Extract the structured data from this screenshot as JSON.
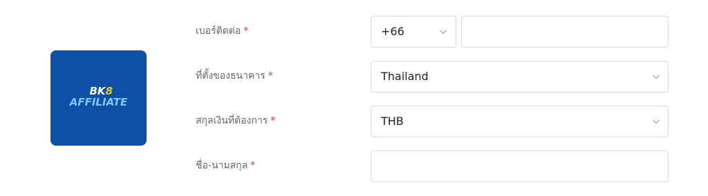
{
  "logo": {
    "brand_prefix": "BK",
    "brand_number": "8",
    "brand_sub": "AFFILIATE"
  },
  "form": {
    "required_mark": "*",
    "phone": {
      "label": "เบอร์ติดต่อ",
      "code": "+66",
      "value": ""
    },
    "bank_location": {
      "label": "ที่ตั้งของธนาคาร",
      "value": "Thailand"
    },
    "currency": {
      "label": "สกุลเงินที่ต้องการ",
      "value": "THB"
    },
    "full_name": {
      "label": "ชื่อ-นามสกุล",
      "value": ""
    }
  },
  "colors": {
    "logo_bg": "#0e4fa8",
    "required": "#d9343a",
    "border": "#d9d9d9"
  },
  "icons": [
    "chevron-down-icon"
  ]
}
